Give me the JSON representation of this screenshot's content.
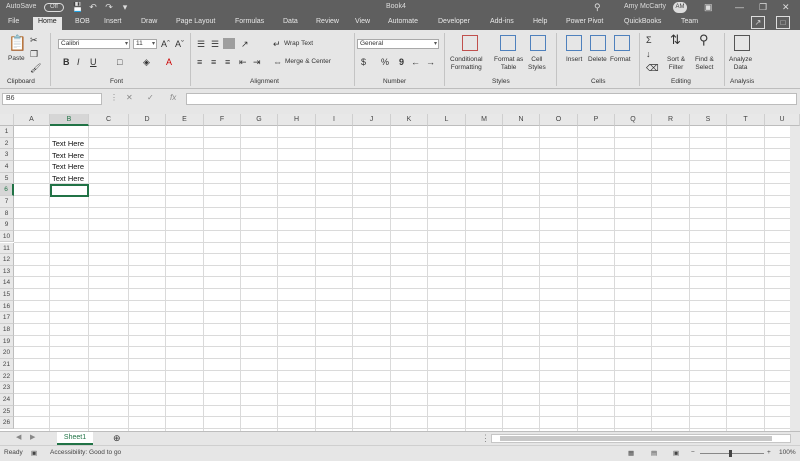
{
  "titlebar": {
    "autosave": "AutoSave",
    "toggle": "Off",
    "doc_title": "Book4",
    "user": "Amy McCarty",
    "initials": "AM"
  },
  "tabs": [
    "File",
    "Home",
    "BOB",
    "Insert",
    "Draw",
    "Page Layout",
    "Formulas",
    "Data",
    "Review",
    "View",
    "Automate",
    "Developer",
    "Add-ins",
    "Help",
    "Power Pivot",
    "QuickBooks",
    "Team"
  ],
  "ribbon": {
    "clipboard": {
      "paste": "Paste",
      "label": "Clipboard"
    },
    "font": {
      "name": "Calibri",
      "size": "11",
      "label": "Font",
      "bold": "B",
      "italic": "I",
      "underline": "U"
    },
    "alignment": {
      "wrap": "Wrap Text",
      "merge": "Merge & Center",
      "label": "Alignment"
    },
    "number": {
      "format": "General",
      "label": "Number",
      "currency": "$",
      "percent": "%",
      "comma": "9"
    },
    "styles": {
      "conditional": "Conditional",
      "conditional2": "Formatting",
      "format_table": "Format as",
      "format_table2": "Table",
      "cell_styles": "Cell",
      "cell_styles2": "Styles",
      "label": "Styles"
    },
    "cells": {
      "insert": "Insert",
      "delete": "Delete",
      "format": "Format",
      "label": "Cells"
    },
    "editing": {
      "sort": "Sort &",
      "sort2": "Filter",
      "find": "Find &",
      "find2": "Select",
      "label": "Editing"
    },
    "analysis": {
      "analyze": "Analyze",
      "analyze2": "Data",
      "label": "Analysis"
    }
  },
  "formula_bar": {
    "name_box": "B6",
    "fx": "fx",
    "value": ""
  },
  "columns": [
    "A",
    "B",
    "C",
    "D",
    "E",
    "F",
    "G",
    "H",
    "I",
    "J",
    "K",
    "L",
    "M",
    "N",
    "O",
    "P",
    "Q",
    "R",
    "S",
    "T",
    "U"
  ],
  "rows": [
    "1",
    "2",
    "3",
    "4",
    "5",
    "6",
    "7",
    "8",
    "9",
    "10",
    "11",
    "12",
    "13",
    "14",
    "15",
    "16",
    "17",
    "18",
    "19",
    "20",
    "21",
    "22",
    "23",
    "24",
    "25",
    "26"
  ],
  "cells": [
    {
      "ref": "B2",
      "text": "Text Here"
    },
    {
      "ref": "B3",
      "text": "Text Here"
    },
    {
      "ref": "B4",
      "text": "Text Here"
    },
    {
      "ref": "B5",
      "text": "Text Here"
    }
  ],
  "sheets": [
    "Sheet1"
  ],
  "status": {
    "ready": "Ready",
    "accessibility": "Accessibility: Good to go",
    "zoom": "100%"
  }
}
